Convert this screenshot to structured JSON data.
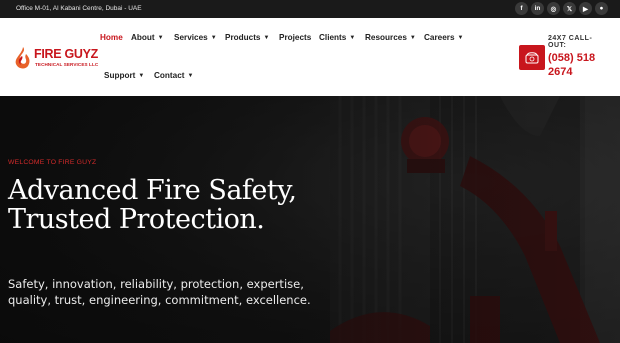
{
  "topbar": {
    "address": "Office M-01, Al Kabani Centre, Dubai - UAE",
    "social": [
      {
        "icon": "facebook-icon",
        "glyph": "f"
      },
      {
        "icon": "linkedin-icon",
        "glyph": "in"
      },
      {
        "icon": "instagram-icon",
        "glyph": "◎"
      },
      {
        "icon": "x-icon",
        "glyph": "𝕏"
      },
      {
        "icon": "youtube-icon",
        "glyph": "▶"
      },
      {
        "icon": "globe-icon",
        "glyph": "●"
      }
    ]
  },
  "brand": {
    "name": "FIRE GUYZ",
    "sub": "TECHNICAL SERVICES LLC",
    "accent": "#c8161d"
  },
  "nav": {
    "home": "Home",
    "about": "About",
    "services": "Services",
    "products": "Products",
    "projects": "Projects",
    "clients": "Clients",
    "resources": "Resources",
    "careers": "Careers",
    "support": "Support",
    "contact": "Contact"
  },
  "call": {
    "label": "24X7 CALL-OUT:",
    "number": "(058) 518 2674",
    "icon": "phone-icon"
  },
  "hero": {
    "kicker": "WELCOME TO FIRE GUYZ",
    "headline": "Advanced Fire Safety, Trusted Protection.",
    "tagline": "Safety, innovation, reliability, protection, expertise, quality, trust, engineering, commitment, excellence."
  }
}
